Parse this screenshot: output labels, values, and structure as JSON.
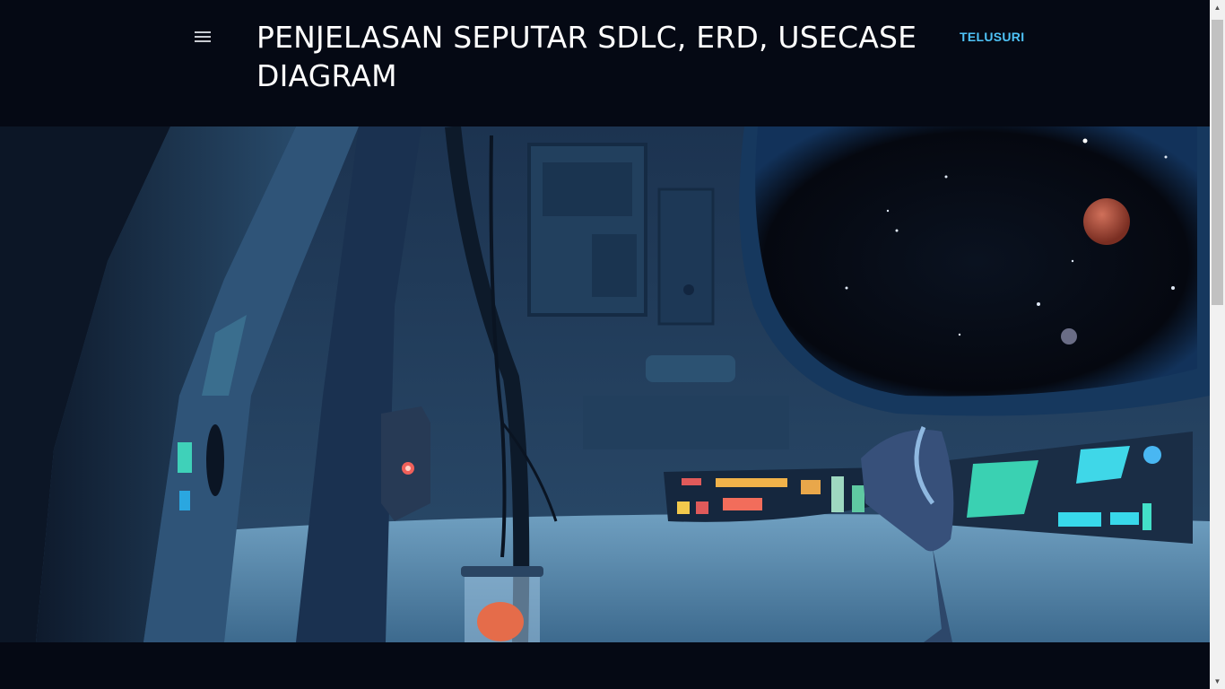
{
  "header": {
    "title": "PENJELASAN SEPUTAR SDLC, ERD, USECASE DIAGRAM",
    "search_label": "TELUSURI",
    "menu_icon": "hamburger-menu-icon"
  },
  "hero": {
    "image": "spaceship-interior-illustration"
  },
  "colors": {
    "background": "#050914",
    "accent": "#4fc3f7",
    "title": "#ffffff"
  },
  "scrollbar": {
    "up_arrow": "▲",
    "down_arrow": "▼"
  }
}
